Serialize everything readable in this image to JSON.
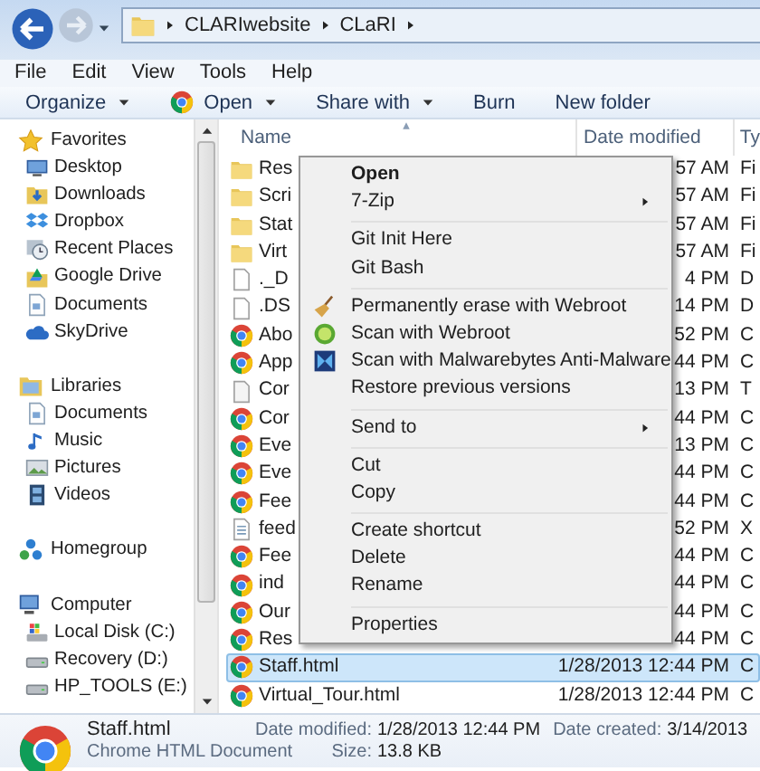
{
  "address_bar": {
    "crumbs": [
      "CLARIwebsite",
      "CLaRI"
    ]
  },
  "menu_bar": [
    "File",
    "Edit",
    "View",
    "Tools",
    "Help"
  ],
  "toolbar": [
    {
      "label": "Organize",
      "dropdown": true,
      "kind": "plain"
    },
    {
      "label": "Open",
      "dropdown": true,
      "kind": "app"
    },
    {
      "label": "Share with",
      "dropdown": true,
      "kind": "plain"
    },
    {
      "label": "Burn",
      "dropdown": false,
      "kind": "plain"
    },
    {
      "label": "New folder",
      "dropdown": false,
      "kind": "plain"
    }
  ],
  "navigation": [
    {
      "label": "Favorites",
      "kind": "star",
      "children": [
        {
          "label": "Desktop",
          "kind": "desktop"
        },
        {
          "label": "Downloads",
          "kind": "downloads"
        },
        {
          "label": "Dropbox",
          "kind": "dropbox"
        },
        {
          "label": "Recent Places",
          "kind": "recent"
        },
        {
          "label": "Google Drive",
          "kind": "gdrive"
        },
        {
          "label": "Documents",
          "kind": "documents"
        },
        {
          "label": "SkyDrive",
          "kind": "cloud"
        }
      ]
    },
    {
      "label": "Libraries",
      "kind": "libraries",
      "children": [
        {
          "label": "Documents",
          "kind": "documents"
        },
        {
          "label": "Music",
          "kind": "music"
        },
        {
          "label": "Pictures",
          "kind": "pictures"
        },
        {
          "label": "Videos",
          "kind": "videos"
        }
      ]
    },
    {
      "label": "Homegroup",
      "kind": "homegroup"
    },
    {
      "label": "Computer",
      "kind": "computer",
      "children": [
        {
          "label": "Local Disk (C:)",
          "kind": "systemdisk"
        },
        {
          "label": "Recovery (D:)",
          "kind": "disk"
        },
        {
          "label": "HP_TOOLS (E:)",
          "kind": "disk"
        }
      ]
    }
  ],
  "columns": [
    "Name",
    "Date modified",
    "Ty"
  ],
  "files": [
    {
      "name": "Res",
      "kind": "folder",
      "date": "57 AM",
      "type": "Fi",
      "selected": false
    },
    {
      "name": "Scri",
      "kind": "folder",
      "date": "57 AM",
      "type": "Fi",
      "selected": false
    },
    {
      "name": "Stat",
      "kind": "folder",
      "date": "57 AM",
      "type": "Fi",
      "selected": false
    },
    {
      "name": "Virt",
      "kind": "folder",
      "date": "57 AM",
      "type": "Fi",
      "selected": false
    },
    {
      "name": "._D",
      "kind": "blank",
      "date": "4 PM",
      "type": "D",
      "selected": false
    },
    {
      "name": ".DS",
      "kind": "blank",
      "date": "14 PM",
      "type": "D",
      "selected": false
    },
    {
      "name": "Abo",
      "kind": "web",
      "date": "52 PM",
      "type": "C",
      "selected": false
    },
    {
      "name": "App",
      "kind": "web",
      "date": "44 PM",
      "type": "C",
      "selected": false
    },
    {
      "name": "Cor",
      "kind": "text",
      "date": "13 PM",
      "type": "T",
      "selected": false
    },
    {
      "name": "Cor",
      "kind": "web",
      "date": "44 PM",
      "type": "C",
      "selected": false
    },
    {
      "name": "Eve",
      "kind": "web",
      "date": "13 PM",
      "type": "C",
      "selected": false
    },
    {
      "name": "Eve",
      "kind": "web",
      "date": "44 PM",
      "type": "C",
      "selected": false
    },
    {
      "name": "Fee",
      "kind": "web",
      "date": "44 PM",
      "type": "C",
      "selected": false
    },
    {
      "name": "feed",
      "kind": "xml",
      "date": "52 PM",
      "type": "X",
      "selected": false
    },
    {
      "name": "Fee",
      "kind": "web",
      "date": "44 PM",
      "type": "C",
      "selected": false
    },
    {
      "name": "ind",
      "kind": "web",
      "date": "44 PM",
      "type": "C",
      "selected": false
    },
    {
      "name": "Our",
      "kind": "web",
      "date": "44 PM",
      "type": "C",
      "selected": false
    },
    {
      "name": "Res",
      "kind": "web",
      "date": "44 PM",
      "type": "C",
      "selected": false
    },
    {
      "name": "Staff.html",
      "kind": "web",
      "date": "1/28/2013 12:44 PM",
      "type": "C",
      "selected": true
    },
    {
      "name": "Virtual_Tour.html",
      "kind": "web",
      "date": "1/28/2013 12:44 PM",
      "type": "C",
      "selected": false
    }
  ],
  "context_menu": [
    {
      "kind": "default",
      "label": "Open"
    },
    {
      "kind": "submenu",
      "label": "7-Zip"
    },
    {
      "kind": "separator"
    },
    {
      "kind": "item",
      "label": "Git Init Here"
    },
    {
      "kind": "item",
      "label": "Git Bash"
    },
    {
      "kind": "separator"
    },
    {
      "kind": "broom",
      "label": "Permanently erase with Webroot"
    },
    {
      "kind": "badge",
      "label": "Scan with Webroot"
    },
    {
      "kind": "emblem",
      "label": "Scan with Malwarebytes Anti-Malware"
    },
    {
      "kind": "item",
      "label": "Restore previous versions"
    },
    {
      "kind": "separator"
    },
    {
      "kind": "submenu",
      "label": "Send to"
    },
    {
      "kind": "separator"
    },
    {
      "kind": "item",
      "label": "Cut"
    },
    {
      "kind": "item",
      "label": "Copy"
    },
    {
      "kind": "separator"
    },
    {
      "kind": "item",
      "label": "Create shortcut"
    },
    {
      "kind": "item",
      "label": "Delete"
    },
    {
      "kind": "item",
      "label": "Rename"
    },
    {
      "kind": "separator"
    },
    {
      "kind": "item",
      "label": "Properties"
    }
  ],
  "details": {
    "name": "Staff.html",
    "type": "Chrome HTML Document",
    "fields": [
      {
        "label": "Date modified:",
        "value": "1/28/2013 12:44 PM"
      },
      {
        "label": "Size:",
        "value": "13.8 KB"
      },
      {
        "label": "Date created:",
        "value": "3/14/2013"
      }
    ]
  }
}
